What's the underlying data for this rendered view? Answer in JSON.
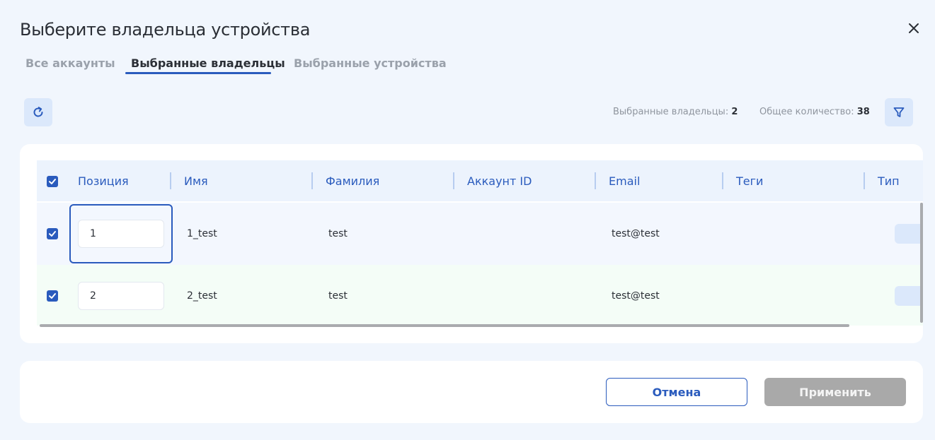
{
  "dialog": {
    "title": "Выберите владельца устройства"
  },
  "tabs": [
    {
      "label": "Все аккаунты",
      "active": false
    },
    {
      "label": "Выбранные владельцы",
      "active": true
    },
    {
      "label": "Выбранные устройства",
      "active": false
    }
  ],
  "toolbar": {
    "refresh_icon": "refresh-icon",
    "filter_icon": "filter-icon",
    "selected_label": "Выбранные владельцы:",
    "selected_count": "2",
    "total_label": "Общее количество:",
    "total_count": "38"
  },
  "table": {
    "columns": [
      "Позиция",
      "Имя",
      "Фамилия",
      "Аккаунт ID",
      "Email",
      "Теги",
      "Тип"
    ],
    "header_checked": true,
    "rows": [
      {
        "checked": true,
        "position": "1",
        "name": "1_test",
        "surname": "test",
        "account_id": "",
        "email": "test@test",
        "tags": ""
      },
      {
        "checked": true,
        "position": "2",
        "name": "2_test",
        "surname": "test",
        "account_id": "",
        "email": "test@test",
        "tags": ""
      }
    ]
  },
  "footer": {
    "cancel_label": "Отмена",
    "apply_label": "Применить"
  },
  "colors": {
    "accent": "#2a5bbd",
    "background": "#f1f6fd",
    "disabled_button": "#a9a9a9"
  }
}
